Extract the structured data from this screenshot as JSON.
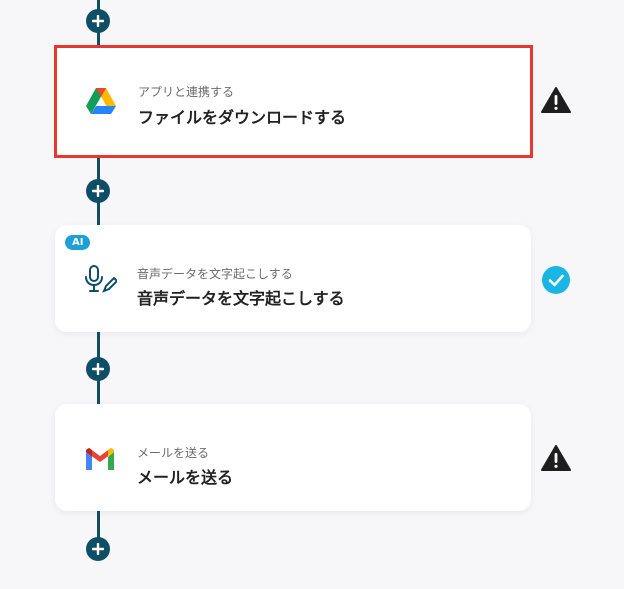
{
  "steps": [
    {
      "sub": "アプリと連携する",
      "title": "ファイルをダウンロードする",
      "icon": "google-drive-icon",
      "status": "warning-icon",
      "selected": true
    },
    {
      "badge": "AI",
      "sub": "音声データを文字起こしする",
      "title": "音声データを文字起こしする",
      "icon": "microphone-pen-icon",
      "status": "check-icon"
    },
    {
      "sub": "メールを送る",
      "title": "メールを送る",
      "icon": "gmail-icon",
      "status": "warning-icon"
    }
  ],
  "colors": {
    "flow_line": "#0e4f66",
    "selected_border": "#e8372c",
    "ai_badge": "#1f9fd8",
    "check": "#1ab6e3"
  }
}
